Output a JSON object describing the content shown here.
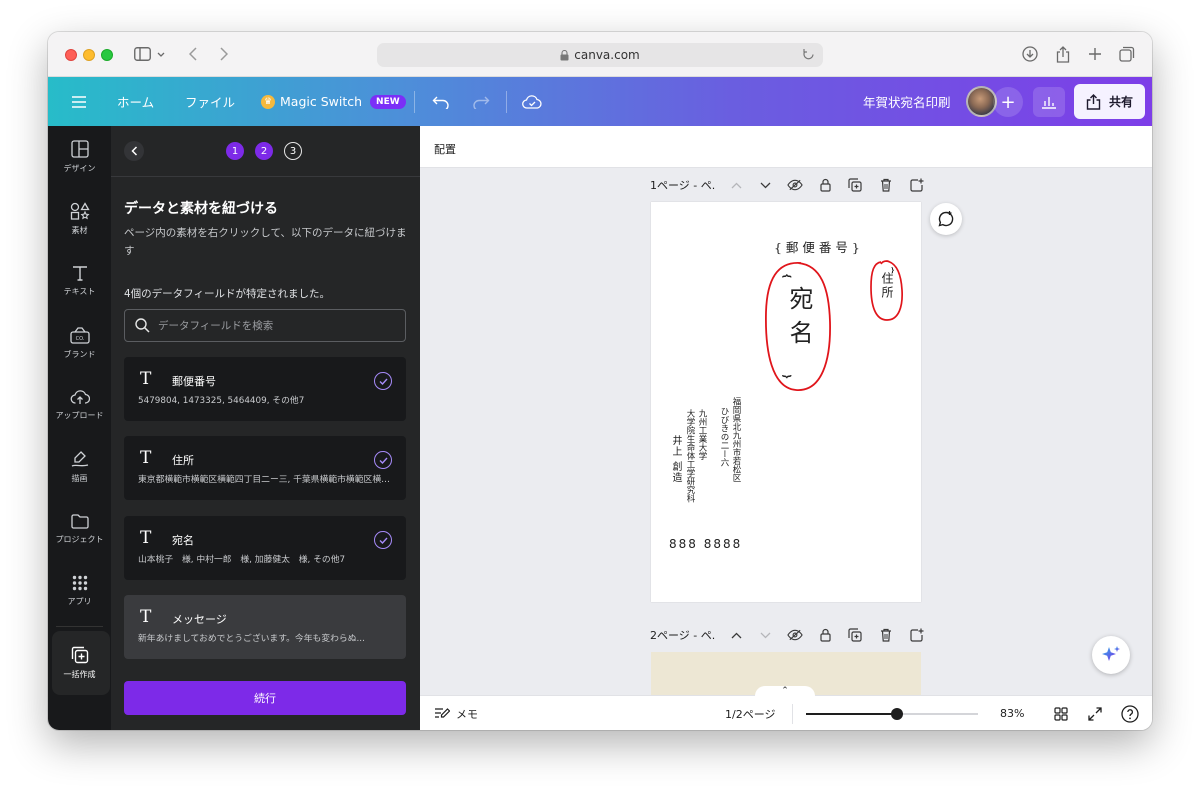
{
  "browser": {
    "url": "canva.com"
  },
  "topbar": {
    "home": "ホーム",
    "file": "ファイル",
    "magic_switch": "Magic Switch",
    "new_badge": "NEW",
    "doc_title": "年賀状宛名印刷",
    "share": "共有"
  },
  "rail": {
    "items": [
      {
        "label": "デザイン",
        "icon": "layout-icon"
      },
      {
        "label": "素材",
        "icon": "shapes-icon"
      },
      {
        "label": "テキスト",
        "icon": "text-icon"
      },
      {
        "label": "ブランド",
        "icon": "brand-icon"
      },
      {
        "label": "アップロード",
        "icon": "upload-icon"
      },
      {
        "label": "描画",
        "icon": "draw-icon"
      },
      {
        "label": "プロジェクト",
        "icon": "folder-icon"
      },
      {
        "label": "アプリ",
        "icon": "apps-icon"
      }
    ],
    "active": {
      "label": "一括作成",
      "icon": "bulk-create-icon"
    }
  },
  "panel": {
    "steps": [
      "1",
      "2",
      "3"
    ],
    "title": "データと素材を紐づける",
    "description": "ページ内の素材を右クリックして、以下のデータに紐づけます",
    "field_count": "4個のデータフィールドが特定されました。",
    "search_placeholder": "データフィールドを検索",
    "fields": [
      {
        "name": "郵便番号",
        "values": "5479804, 1473325, 5464409, その他7",
        "checked": true
      },
      {
        "name": "住所",
        "values": "東京都横範市横範区横範四丁目二ー三, 千葉県横範市横範区横範...",
        "checked": true
      },
      {
        "name": "宛名",
        "values": "山本桃子　様, 中村一郎　様, 加藤健太　様, その他7",
        "checked": true
      },
      {
        "name": "メッセージ",
        "values": "新年あけましておめでとうございます。今年も変わらぬ...",
        "checked": false
      }
    ],
    "continue": "続行"
  },
  "canvas": {
    "arrange": "配置",
    "pages": [
      {
        "label": "1ページ - ペ."
      },
      {
        "label": "2ページ - ペ."
      }
    ],
    "postcard": {
      "postal_placeholder": "{ 郵 便 番 号 }",
      "address_placeholder": "住所",
      "name_placeholder": "宛名",
      "sender_address_1": "福岡県北九州市若松区",
      "sender_address_2": "ひびきの二ー六",
      "sender_org_1": "九州工業大学",
      "sender_org_2": "大学院生命体工学研究科",
      "sender_name": "井上 創造",
      "sender_postal": "888 8888"
    },
    "memo": "メモ",
    "page_indicator": "1/2ページ",
    "zoom": "83%",
    "zoom_fraction": 0.53
  },
  "colors": {
    "accent": "#7d2ae8",
    "annotation": "#e0151b"
  }
}
